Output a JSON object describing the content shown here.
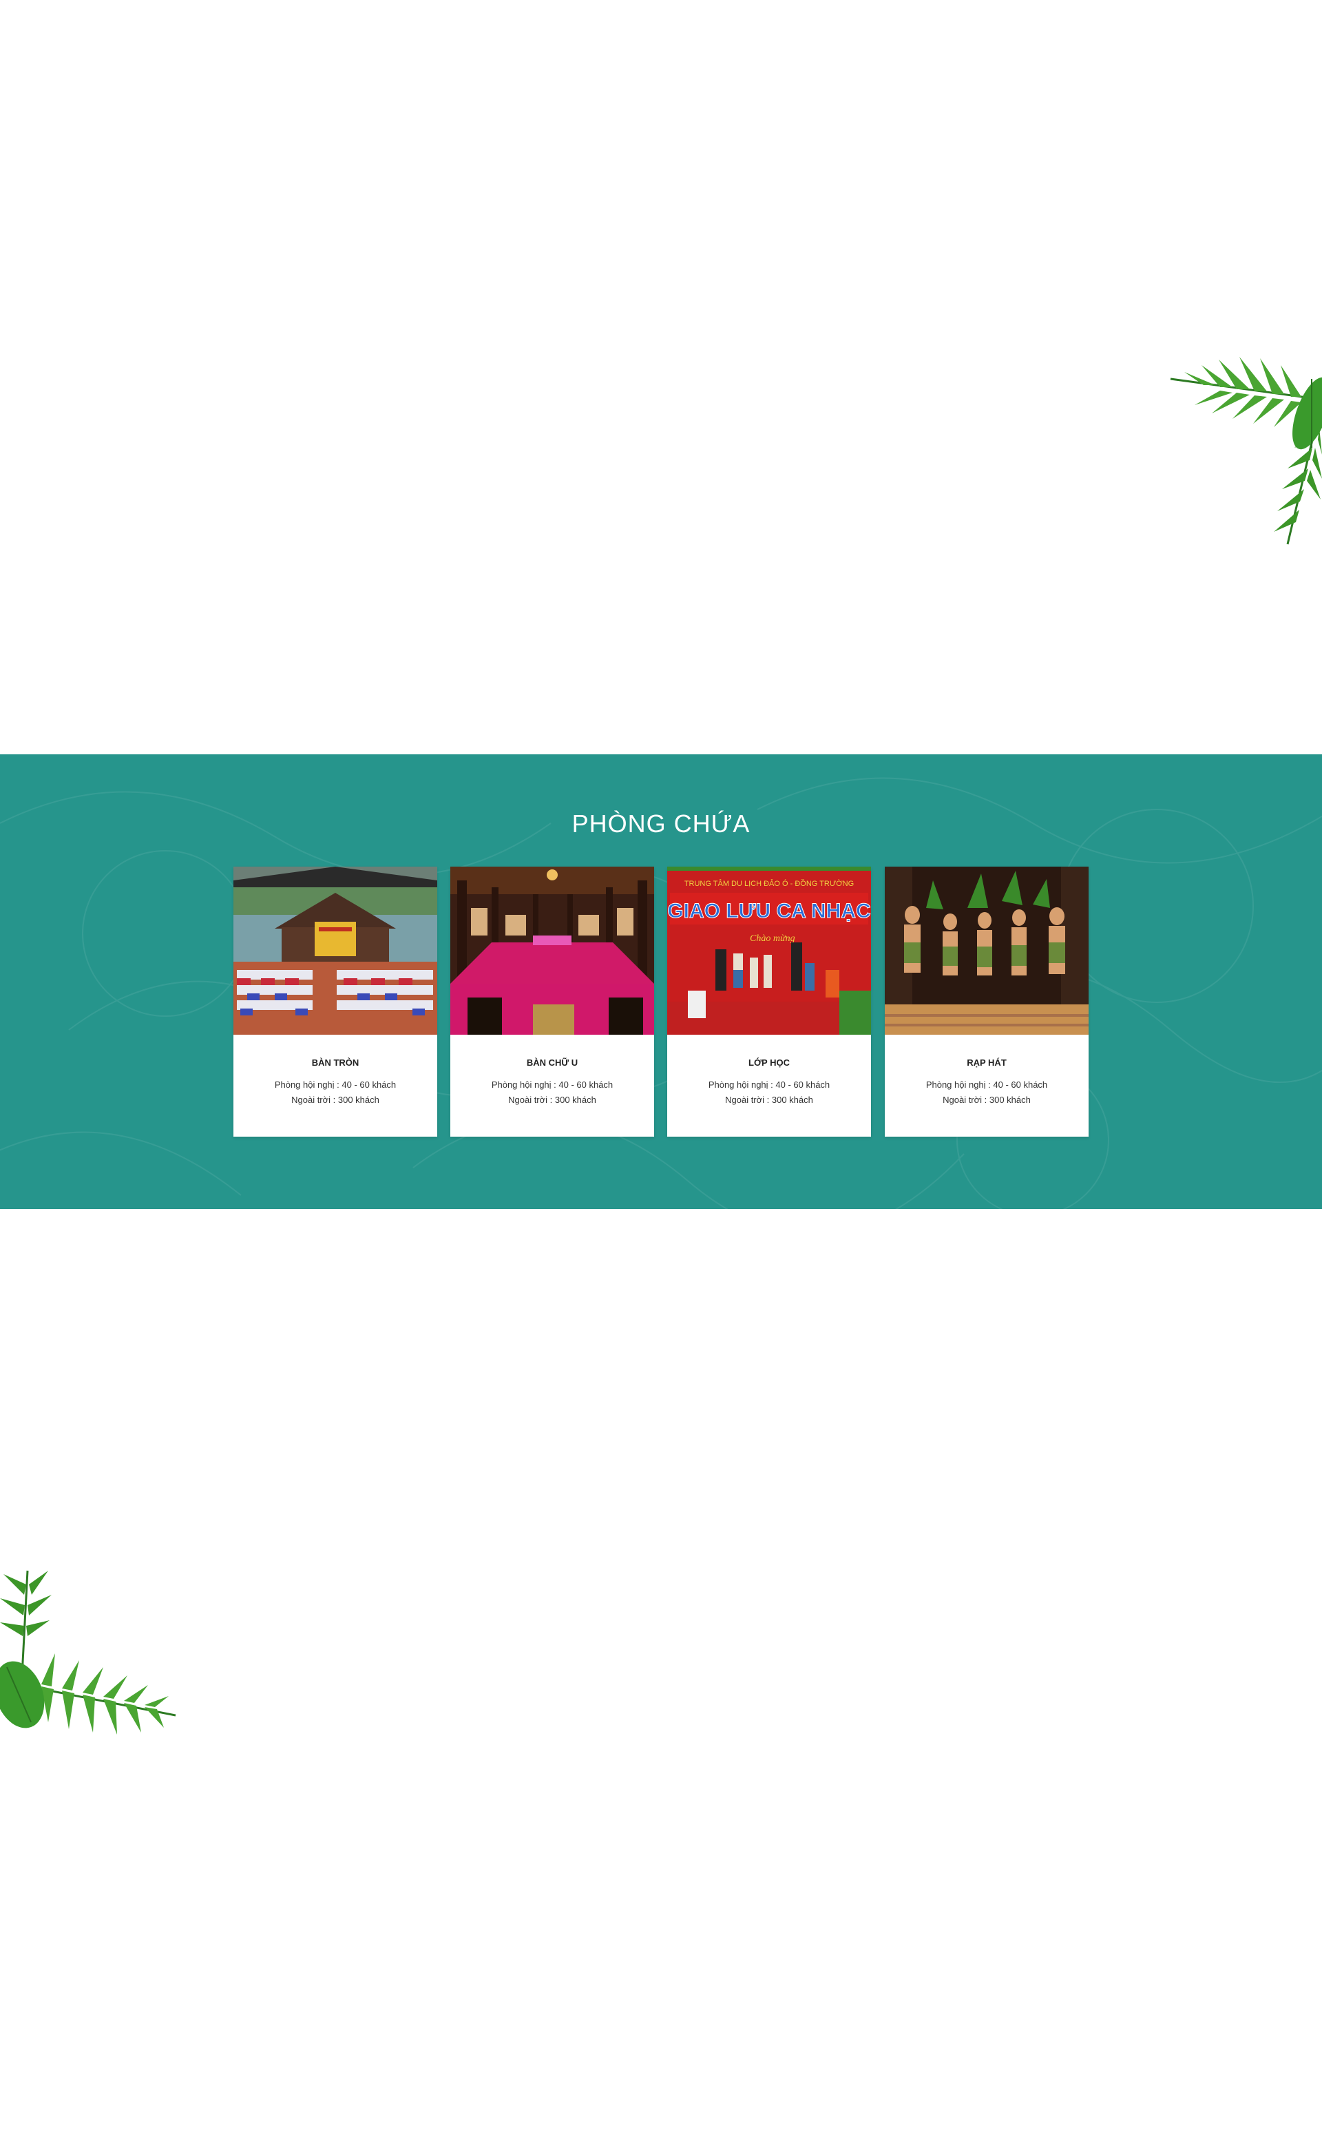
{
  "section": {
    "title": "PHÒNG CHỨA",
    "background_color": "#26958c"
  },
  "cards": [
    {
      "title": "BÀN TRÒN",
      "line_1": "Phòng hội nghị : 40 - 60 khách",
      "line_2": "Ngoài trời : 300 khách",
      "image": "conference-hall-photo"
    },
    {
      "title": "BÀN CHỮ U",
      "line_1": "Phòng hội nghị : 40 - 60 khách",
      "line_2": "Ngoài trời : 300 khách",
      "image": "u-shape-table-photo"
    },
    {
      "title": "LỚP HỌC",
      "line_1": "Phòng hội nghị : 40 - 60 khách",
      "line_2": "Ngoài trời : 300 khách",
      "image": "music-stage-photo",
      "banner_top": "TRUNG TÂM DU LỊCH ĐẢO Ó - ĐỒNG TRƯỜNG",
      "banner_main": "GIAO LƯU CA NHẠC"
    },
    {
      "title": "RẠP HÁT",
      "line_1": "Phòng hội nghị : 40 - 60 khách",
      "line_2": "Ngoài trời : 300 khách",
      "image": "performers-photo"
    }
  ],
  "decor": {
    "leaf_color": "#3f9a2e",
    "leaf_dark": "#2c7a22"
  }
}
